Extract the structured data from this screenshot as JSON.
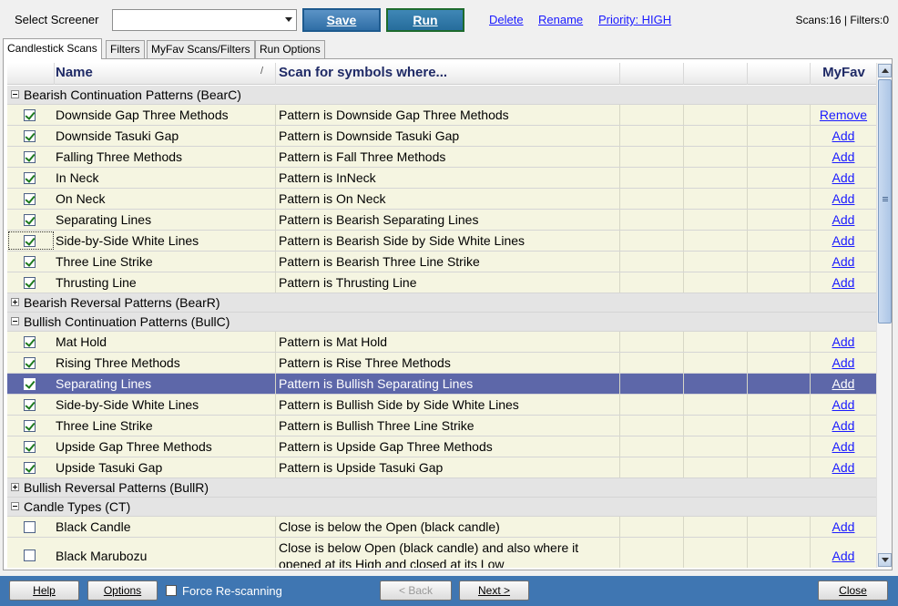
{
  "toolbar": {
    "select_label": "Select Screener",
    "screener_value": "",
    "save_label": "Save",
    "run_label": "Run",
    "delete_label": "Delete",
    "rename_label": "Rename",
    "priority_label": "Priority: HIGH",
    "counts": "Scans:16 | Filters:0"
  },
  "tabs": [
    "Candlestick Scans",
    "Filters",
    "MyFav Scans/Filters",
    "Run Options"
  ],
  "grid": {
    "col_name": "Name",
    "col_scan": "Scan for symbols where...",
    "col_myfav": "MyFav",
    "sort_mark": "/",
    "rows": [
      {
        "kind": "group",
        "label": "Bearish Continuation Patterns (BearC)",
        "expanded": true
      },
      {
        "kind": "data",
        "checked": true,
        "name": "Downside Gap Three Methods",
        "desc": "Pattern is Downside Gap Three Methods",
        "fav": "Remove"
      },
      {
        "kind": "data",
        "checked": true,
        "name": "Downside Tasuki Gap",
        "desc": "Pattern is Downside Tasuki Gap",
        "fav": "Add"
      },
      {
        "kind": "data",
        "checked": true,
        "name": "Falling Three Methods",
        "desc": "Pattern is Fall Three Methods",
        "fav": "Add"
      },
      {
        "kind": "data",
        "checked": true,
        "name": "In Neck",
        "desc": "Pattern is InNeck",
        "fav": "Add"
      },
      {
        "kind": "data",
        "checked": true,
        "name": "On Neck",
        "desc": "Pattern is On Neck",
        "fav": "Add"
      },
      {
        "kind": "data",
        "checked": true,
        "name": "Separating Lines",
        "desc": "Pattern is Bearish Separating Lines",
        "fav": "Add"
      },
      {
        "kind": "data",
        "checked": true,
        "name": "Side-by-Side White Lines",
        "desc": "Pattern is Bearish Side by Side White Lines",
        "fav": "Add",
        "focus": true
      },
      {
        "kind": "data",
        "checked": true,
        "name": "Three Line Strike",
        "desc": "Pattern is Bearish Three Line Strike",
        "fav": "Add"
      },
      {
        "kind": "data",
        "checked": true,
        "name": "Thrusting Line",
        "desc": "Pattern is Thrusting Line",
        "fav": "Add"
      },
      {
        "kind": "group",
        "label": "Bearish Reversal Patterns (BearR)",
        "expanded": false
      },
      {
        "kind": "group",
        "label": "Bullish Continuation Patterns (BullC)",
        "expanded": true
      },
      {
        "kind": "data",
        "checked": true,
        "name": "Mat Hold",
        "desc": "Pattern is Mat Hold",
        "fav": "Add"
      },
      {
        "kind": "data",
        "checked": true,
        "name": "Rising Three Methods",
        "desc": "Pattern is Rise Three Methods",
        "fav": "Add"
      },
      {
        "kind": "data",
        "checked": true,
        "name": "Separating Lines",
        "desc": "Pattern is Bullish Separating Lines",
        "fav": "Add",
        "selected": true
      },
      {
        "kind": "data",
        "checked": true,
        "name": "Side-by-Side White Lines",
        "desc": "Pattern is Bullish Side by Side White Lines",
        "fav": "Add"
      },
      {
        "kind": "data",
        "checked": true,
        "name": "Three Line Strike",
        "desc": "Pattern is Bullish Three Line Strike",
        "fav": "Add"
      },
      {
        "kind": "data",
        "checked": true,
        "name": "Upside Gap Three Methods",
        "desc": "Pattern is Upside Gap Three Methods",
        "fav": "Add"
      },
      {
        "kind": "data",
        "checked": true,
        "name": "Upside Tasuki Gap",
        "desc": "Pattern is Upside Tasuki Gap",
        "fav": "Add"
      },
      {
        "kind": "group",
        "label": "Bullish Reversal Patterns (BullR)",
        "expanded": false
      },
      {
        "kind": "group",
        "label": "Candle Types (CT)",
        "expanded": true
      },
      {
        "kind": "data",
        "checked": false,
        "name": "Black Candle",
        "desc": "Close is below the Open (black candle)",
        "fav": "Add"
      },
      {
        "kind": "data",
        "checked": false,
        "name": "Black Marubozu",
        "desc": "Close is below Open (black candle) and also where it opened at its High and closed at its Low",
        "fav": "Add",
        "tall": true
      }
    ]
  },
  "bottom": {
    "help_label": "Help",
    "options_label": "Options",
    "force_label": "Force Re-scanning",
    "force_checked": false,
    "back_label": "< Back",
    "next_label": "Next >",
    "close_label": "Close"
  }
}
